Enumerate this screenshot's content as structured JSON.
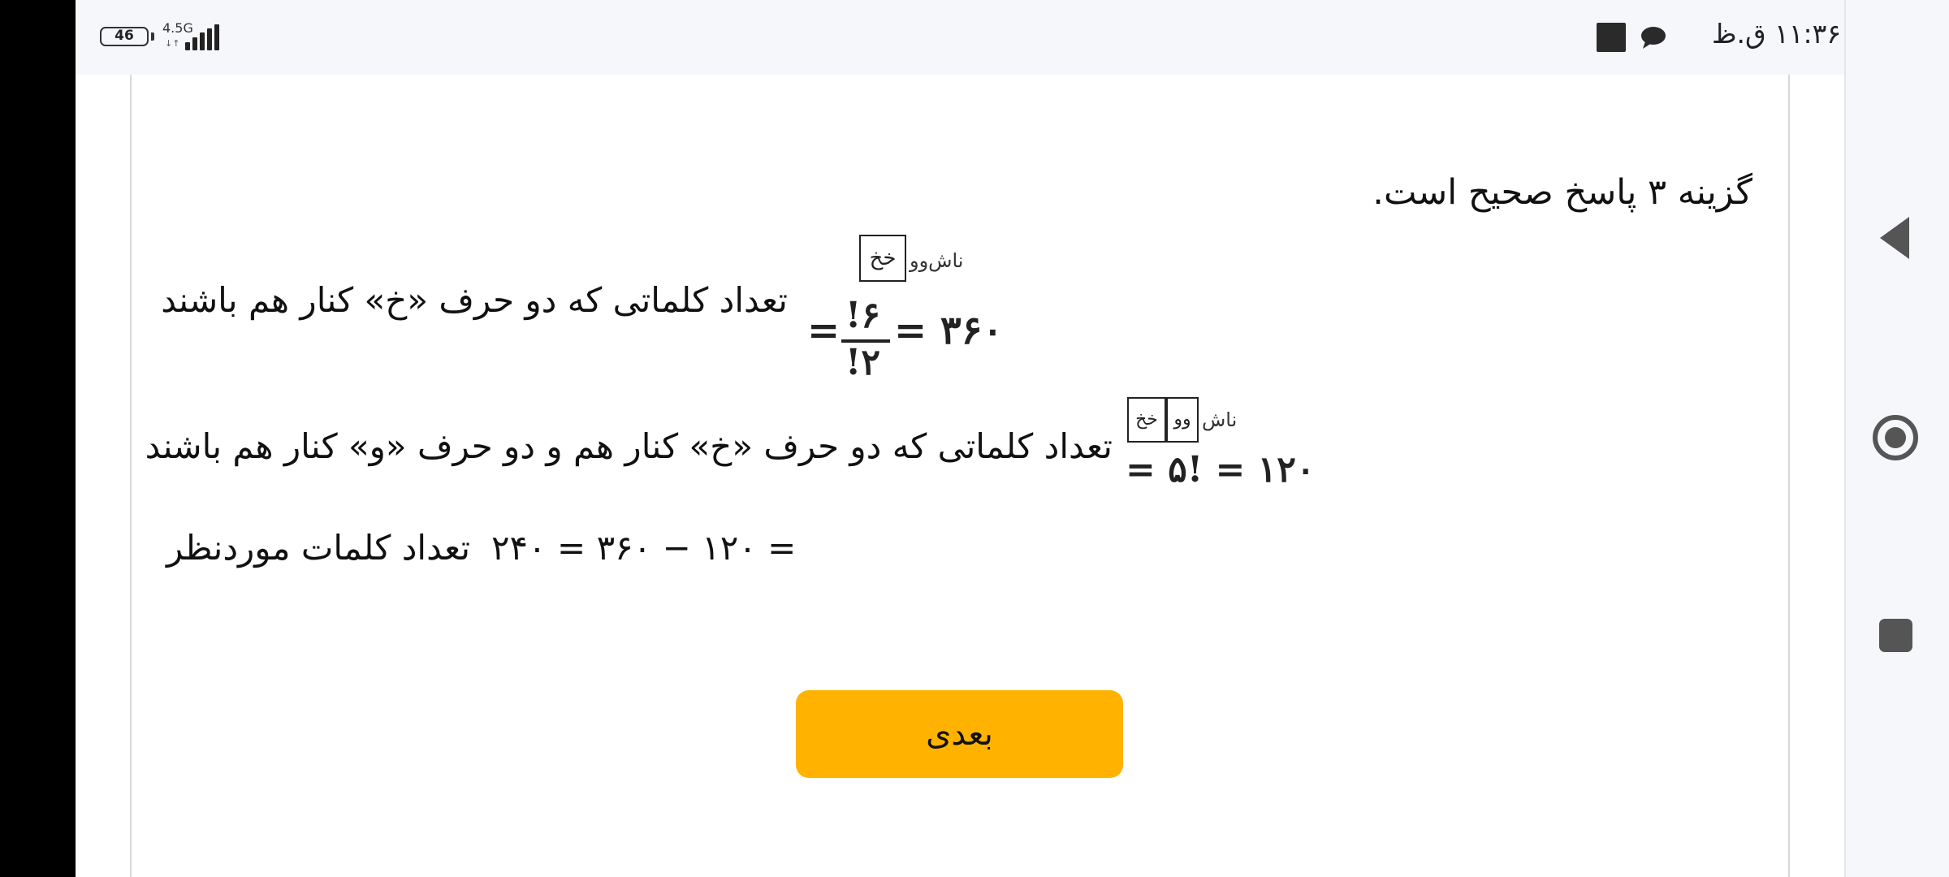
{
  "status_bar": {
    "battery": "46",
    "network_type": "4.5G",
    "network_arrows": "↓↑",
    "clock": "۱۱:۳۶ ق.ظ"
  },
  "content": {
    "answer": "گزینه ۳ پاسخ صحیح است.",
    "line1_text": "تعداد کلماتی که دو حرف «خ» کنار هم باشند",
    "formula1": {
      "box": "خخ",
      "letters": "ناش‌وو",
      "numerator": "!۶",
      "denominator": "!۲",
      "result": "= ۳۶۰"
    },
    "line2_text": "تعداد کلماتی که دو حرف «خ» کنار هم و دو حرف «و» کنار هم باشند",
    "formula2": {
      "box1": "وو",
      "box2": "خخ",
      "letters": "ناش",
      "expression": "= ۵! = ۱۲۰"
    },
    "line3_label": "تعداد کلمات موردنظر",
    "line3_equation": "۲۴۰ = ۳۶۰ − ۱۲۰ ="
  },
  "button": {
    "next_label": "بعدی"
  },
  "icons": {
    "battery": "battery-icon",
    "signal": "signal-icon",
    "chat": "chat-icon",
    "square": "square-icon",
    "back": "back-icon",
    "home": "home-icon",
    "recent": "recent-apps-icon"
  },
  "colors": {
    "button": "#ffb300",
    "status_bar": "#f5f7fb"
  }
}
